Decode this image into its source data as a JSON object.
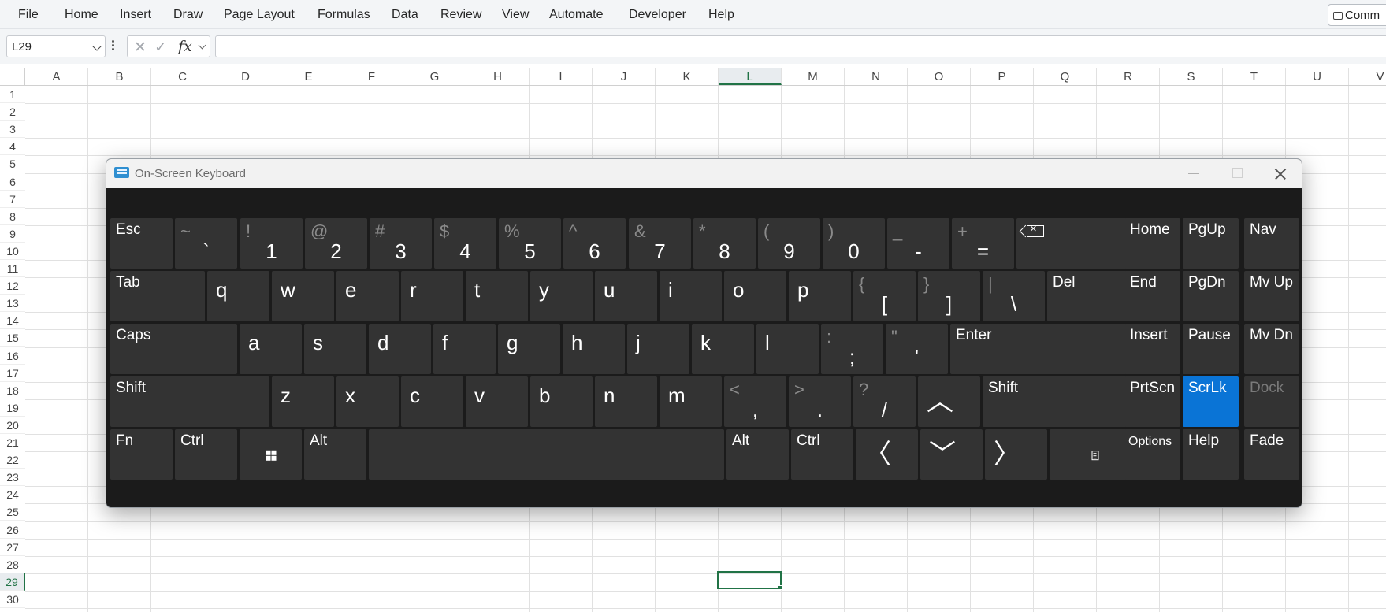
{
  "menu": {
    "items": [
      "File",
      "Home",
      "Insert",
      "Draw",
      "Page Layout",
      "Formulas",
      "Data",
      "Review",
      "View",
      "Automate",
      "Developer",
      "Help"
    ],
    "comments_label": "Comm"
  },
  "formula_bar": {
    "name_box": "L29",
    "fx_label": "fx",
    "formula": ""
  },
  "grid": {
    "columns": [
      "A",
      "B",
      "C",
      "D",
      "E",
      "F",
      "G",
      "H",
      "I",
      "J",
      "K",
      "L",
      "M",
      "N",
      "O",
      "P",
      "Q",
      "R",
      "S",
      "T",
      "U",
      "V"
    ],
    "rows": [
      "1",
      "2",
      "3",
      "4",
      "5",
      "6",
      "7",
      "8",
      "9",
      "10",
      "11",
      "12",
      "13",
      "14",
      "15",
      "16",
      "17",
      "18",
      "19",
      "20",
      "21",
      "22",
      "23",
      "24",
      "25",
      "26",
      "27",
      "28",
      "29",
      "30"
    ],
    "active_column": "L",
    "active_row": "29",
    "accent_color": "#217346"
  },
  "osk": {
    "title": "On-Screen Keyboard",
    "active_color": "#0a74d6",
    "keys": {
      "esc": "Esc",
      "tilde": {
        "top": "~",
        "bottom": "`"
      },
      "1": {
        "top": "!",
        "bottom": "1"
      },
      "2": {
        "top": "@",
        "bottom": "2"
      },
      "3": {
        "top": "#",
        "bottom": "3"
      },
      "4": {
        "top": "$",
        "bottom": "4"
      },
      "5": {
        "top": "%",
        "bottom": "5"
      },
      "6": {
        "top": "^",
        "bottom": "6"
      },
      "7": {
        "top": "&",
        "bottom": "7"
      },
      "8": {
        "top": "*",
        "bottom": "8"
      },
      "9": {
        "top": "(",
        "bottom": "9"
      },
      "0": {
        "top": ")",
        "bottom": "0"
      },
      "minus": {
        "top": "_",
        "bottom": "-"
      },
      "equals": {
        "top": "+",
        "bottom": "="
      },
      "tab": "Tab",
      "q": "q",
      "w": "w",
      "e": "e",
      "r": "r",
      "t": "t",
      "y": "y",
      "u": "u",
      "i": "i",
      "o": "o",
      "p": "p",
      "lbracket": {
        "top": "{",
        "bottom": "["
      },
      "rbracket": {
        "top": "}",
        "bottom": "]"
      },
      "backslash": {
        "top": "|",
        "bottom": "\\"
      },
      "del": "Del",
      "caps": "Caps",
      "a": "a",
      "s": "s",
      "d": "d",
      "f": "f",
      "g": "g",
      "h": "h",
      "j": "j",
      "k": "k",
      "l": "l",
      "semicolon": {
        "top": ":",
        "bottom": ";"
      },
      "quote": {
        "top": "\"",
        "bottom": "'"
      },
      "enter": "Enter",
      "shift_l": "Shift",
      "z": "z",
      "x": "x",
      "c": "c",
      "v": "v",
      "b": "b",
      "n": "n",
      "m": "m",
      "comma": {
        "top": "<",
        "bottom": ","
      },
      "period": {
        "top": ">",
        "bottom": "."
      },
      "slash": {
        "top": "?",
        "bottom": "/"
      },
      "up": "^",
      "shift_r": "Shift",
      "fn": "Fn",
      "ctrl_l": "Ctrl",
      "alt_l": "Alt",
      "alt_r": "Alt",
      "ctrl_r": "Ctrl",
      "left": "<",
      "down": "v",
      "right": ">",
      "home": "Home",
      "pgup": "PgUp",
      "nav": "Nav",
      "end": "End",
      "pgdn": "PgDn",
      "mvup": "Mv Up",
      "insert": "Insert",
      "pause": "Pause",
      "mvdn": "Mv Dn",
      "prtscn": "PrtScn",
      "scrlk": "ScrLk",
      "dock": "Dock",
      "options": "Options",
      "help": "Help",
      "fade": "Fade"
    }
  }
}
